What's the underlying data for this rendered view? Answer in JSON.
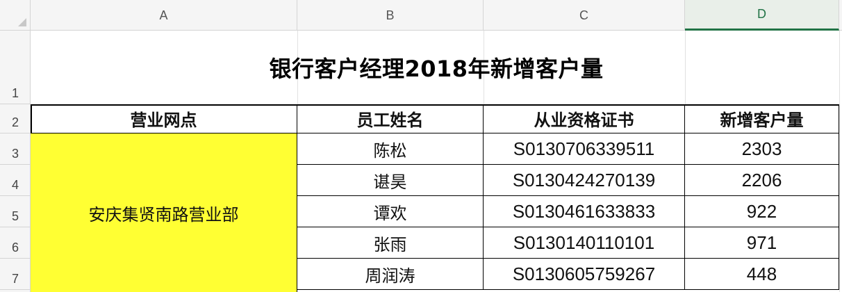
{
  "spreadsheet": {
    "columns": [
      "A",
      "B",
      "C",
      "D"
    ],
    "active_column": "D",
    "rows": [
      "1",
      "2",
      "3",
      "4",
      "5",
      "6",
      "7"
    ],
    "title": "银行客户经理2018年新增客户量",
    "headers": [
      "营业网点",
      "员工姓名",
      "从业资格证书",
      "新增客户量"
    ],
    "branch": "安庆集贤南路营业部",
    "records": [
      {
        "name": "陈松",
        "cert": "S0130706339511",
        "count": "2303"
      },
      {
        "name": "谌昊",
        "cert": "S0130424270139",
        "count": "2206"
      },
      {
        "name": "谭欢",
        "cert": "S0130461633833",
        "count": "922"
      },
      {
        "name": "张雨",
        "cert": "S0130140110101",
        "count": "971"
      },
      {
        "name": "周润涛",
        "cert": "S0130605759267",
        "count": "448"
      }
    ]
  }
}
